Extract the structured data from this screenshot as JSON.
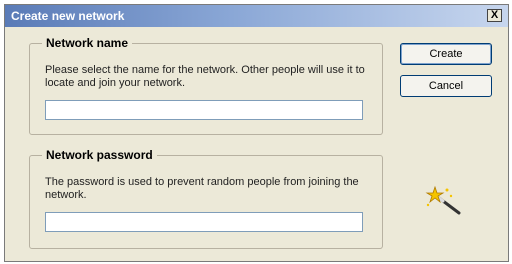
{
  "window": {
    "title": "Create new network",
    "close_label": "X"
  },
  "network_name": {
    "heading": "Network name",
    "description": "Please select the name for the network. Other people will use it to locate and join your network.",
    "value": "",
    "placeholder": ""
  },
  "network_password": {
    "heading": "Network password",
    "description": "The password is used to prevent random people from joining the network.",
    "value": "",
    "placeholder": ""
  },
  "buttons": {
    "create": "Create",
    "cancel": "Cancel"
  },
  "icons": {
    "wizard": "magic-wand-icon"
  }
}
